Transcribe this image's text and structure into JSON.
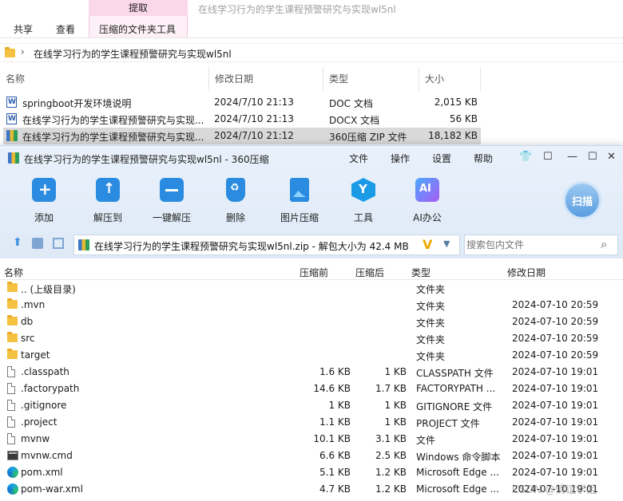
{
  "explorer": {
    "ribbon": {
      "context_tab": "提取",
      "window_title": "在线学习行为的学生课程预警研究与实现wl5nl",
      "tabs": [
        "共享",
        "查看",
        "压缩的文件夹工具"
      ]
    },
    "address_path": "在线学习行为的学生课程预警研究与实现wl5nl",
    "columns": [
      "名称",
      "修改日期",
      "类型",
      "大小"
    ],
    "rows": [
      {
        "name": "springboot开发环境说明",
        "date": "2024/7/10 21:13",
        "type": "DOC 文档",
        "size": "2,015 KB",
        "icon": "word-icon"
      },
      {
        "name": "在线学习行为的学生课程预警研究与实现...",
        "date": "2024/7/10 21:13",
        "type": "DOCX 文档",
        "size": "56 KB",
        "icon": "word-icon"
      },
      {
        "name": "在线学习行为的学生课程预警研究与实现...",
        "date": "2024/7/10 21:12",
        "type": "360压缩 ZIP 文件",
        "size": "18,182 KB",
        "icon": "zip-icon"
      }
    ]
  },
  "zipwin": {
    "title": "在线学习行为的学生课程预警研究与实现wl5nl - 360压缩",
    "menu": [
      "文件",
      "操作",
      "设置",
      "帮助"
    ],
    "toolbar": [
      {
        "label": "添加",
        "icon": "add-icon",
        "color": "#2a8be0"
      },
      {
        "label": "解压到",
        "icon": "extract-to-icon",
        "color": "#2a8be0"
      },
      {
        "label": "一键解压",
        "icon": "one-click-extract-icon",
        "color": "#2a8be0"
      },
      {
        "label": "删除",
        "icon": "delete-icon",
        "color": "#2a8be0"
      },
      {
        "label": "图片压缩",
        "icon": "image-compress-icon",
        "color": "#2a8be0"
      },
      {
        "label": "工具",
        "icon": "tools-icon",
        "color": "#1b9ae6"
      },
      {
        "label": "AI办公",
        "icon": "ai-office-icon",
        "color": "#7b5cf0"
      }
    ],
    "scan_label": "扫描",
    "zip_path": "在线学习行为的学生课程预警研究与实现wl5nl.zip - 解包大小为 42.4 MB",
    "search_placeholder": "搜索包内文件",
    "columns": [
      "名称",
      "压缩前",
      "压缩后",
      "类型",
      "修改日期"
    ],
    "files": [
      {
        "name": ".. (上级目录)",
        "before": "",
        "after": "",
        "type": "文件夹",
        "date": "",
        "icon": "folder-icon"
      },
      {
        "name": ".mvn",
        "before": "",
        "after": "",
        "type": "文件夹",
        "date": "2024-07-10 20:59",
        "icon": "folder-icon"
      },
      {
        "name": "db",
        "before": "",
        "after": "",
        "type": "文件夹",
        "date": "2024-07-10 20:59",
        "icon": "folder-icon"
      },
      {
        "name": "src",
        "before": "",
        "after": "",
        "type": "文件夹",
        "date": "2024-07-10 20:59",
        "icon": "folder-icon"
      },
      {
        "name": "target",
        "before": "",
        "after": "",
        "type": "文件夹",
        "date": "2024-07-10 20:59",
        "icon": "folder-icon"
      },
      {
        "name": ".classpath",
        "before": "1.6 KB",
        "after": "1 KB",
        "type": "CLASSPATH 文件",
        "date": "2024-07-10 19:01",
        "icon": "file-icon"
      },
      {
        "name": ".factorypath",
        "before": "14.6 KB",
        "after": "1.7 KB",
        "type": "FACTORYPATH ...",
        "date": "2024-07-10 19:01",
        "icon": "file-icon"
      },
      {
        "name": ".gitignore",
        "before": "1 KB",
        "after": "1 KB",
        "type": "GITIGNORE 文件",
        "date": "2024-07-10 19:01",
        "icon": "file-icon"
      },
      {
        "name": ".project",
        "before": "1.1 KB",
        "after": "1 KB",
        "type": "PROJECT 文件",
        "date": "2024-07-10 19:01",
        "icon": "file-icon"
      },
      {
        "name": "mvnw",
        "before": "10.1 KB",
        "after": "3.1 KB",
        "type": "文件",
        "date": "2024-07-10 19:01",
        "icon": "file-icon"
      },
      {
        "name": "mvnw.cmd",
        "before": "6.6 KB",
        "after": "2.5 KB",
        "type": "Windows 命令脚本",
        "date": "2024-07-10 19:01",
        "icon": "cmd-icon"
      },
      {
        "name": "pom.xml",
        "before": "5.1 KB",
        "after": "1.2 KB",
        "type": "Microsoft Edge ...",
        "date": "2024-07-10 19:01",
        "icon": "edge-icon"
      },
      {
        "name": "pom-war.xml",
        "before": "4.7 KB",
        "after": "1.2 KB",
        "type": "Microsoft Edge ...",
        "date": "2024-07-10 19:01",
        "icon": "edge-icon"
      }
    ],
    "watermark": "CSDN @情谊学姐"
  }
}
